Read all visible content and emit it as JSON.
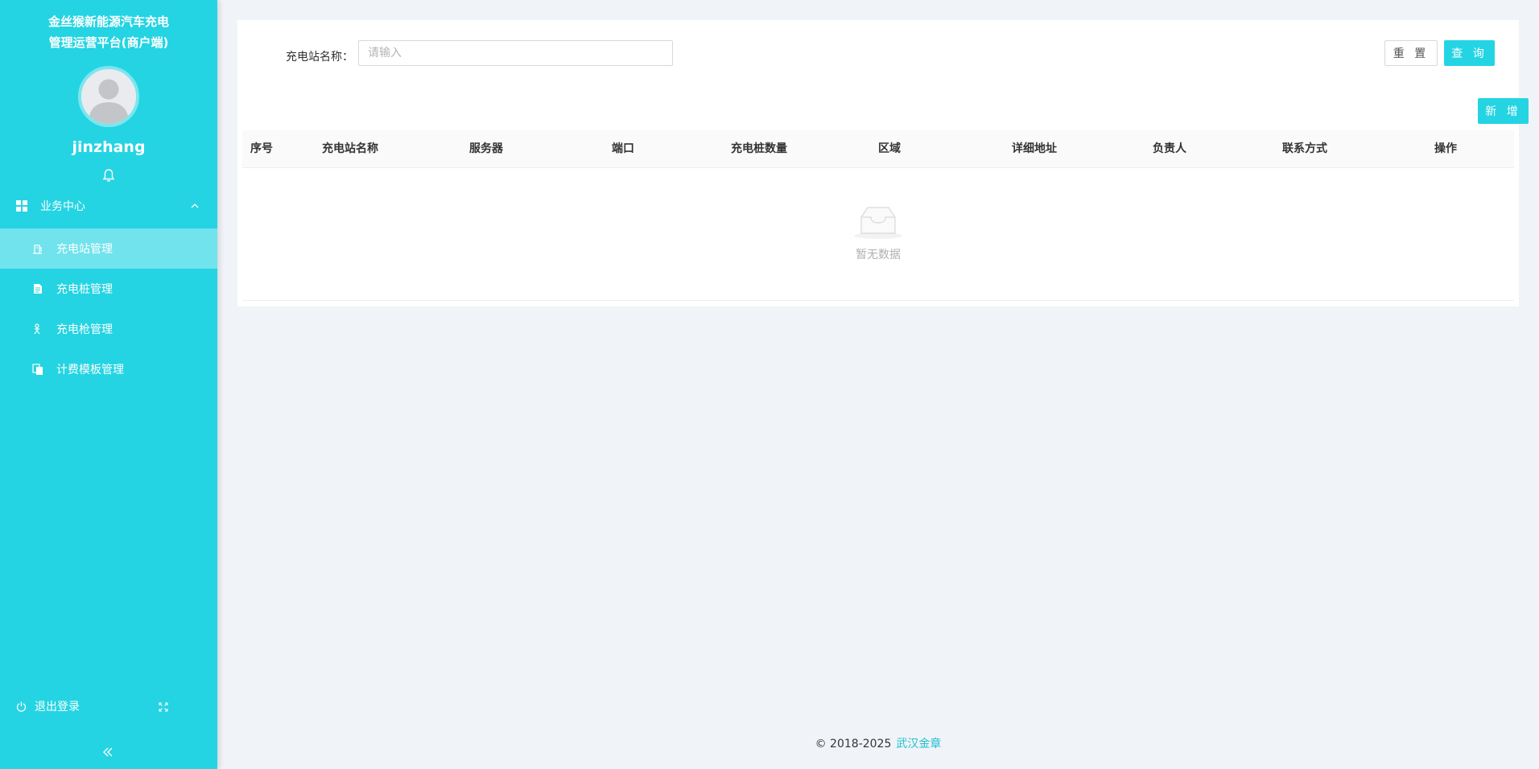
{
  "sidebar": {
    "title_line1": "金丝猴新能源汽车充电",
    "title_line2": "管理运营平台(商户端)",
    "username": "jinzhang",
    "group_label": "业务中心",
    "items": [
      {
        "label": "充电站管理",
        "icon": "station-icon",
        "active": true
      },
      {
        "label": "充电桩管理",
        "icon": "pile-icon",
        "active": false
      },
      {
        "label": "充电枪管理",
        "icon": "gun-icon",
        "active": false
      },
      {
        "label": "计费模板管理",
        "icon": "template-icon",
        "active": false
      }
    ],
    "logout_label": "退出登录"
  },
  "search": {
    "label": "充电站名称：",
    "placeholder": "请输入",
    "value": "",
    "reset_label": "重 置",
    "query_label": "查 询"
  },
  "toolbar": {
    "add_label": "新 增"
  },
  "table": {
    "columns": [
      "序号",
      "充电站名称",
      "服务器",
      "端口",
      "充电桩数量",
      "区域",
      "详细地址",
      "负责人",
      "联系方式",
      "操作"
    ],
    "rows": [],
    "empty_text": "暂无数据"
  },
  "footer": {
    "copyright": "© 2018-2025",
    "company": "武汉金章"
  },
  "colors": {
    "brand": "#24d4e3",
    "page_bg": "#f0f4f8"
  }
}
